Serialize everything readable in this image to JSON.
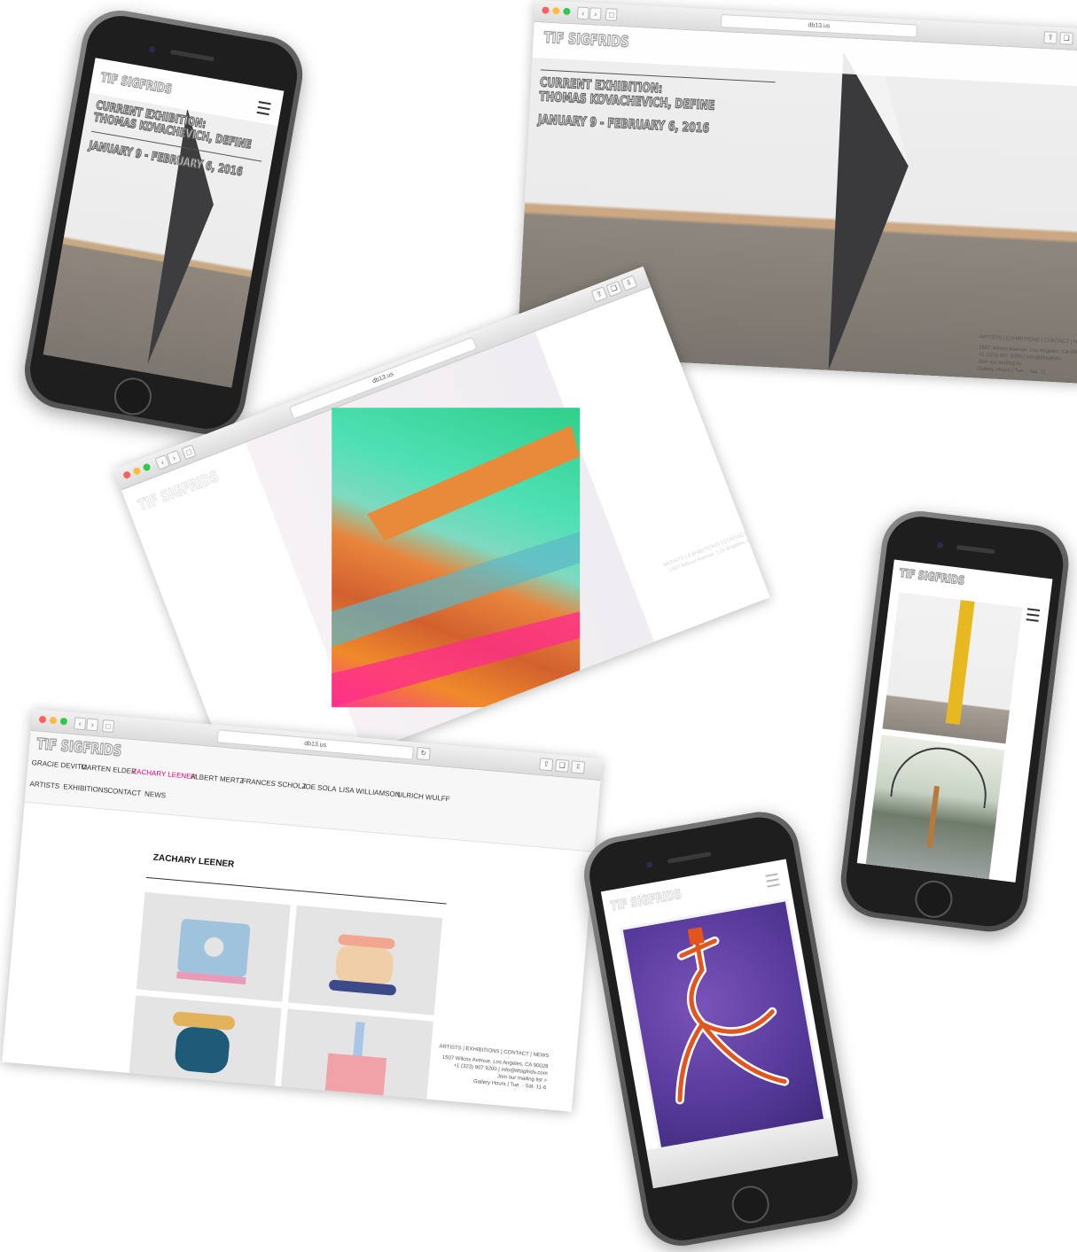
{
  "site": {
    "logo": "TIF SIGFRIDS",
    "url": "db13.us"
  },
  "exhibition": {
    "label": "CURRENT EXHIBITION:",
    "title": "THOMAS KOVACHEVICH, DEFINE",
    "dates": "JANUARY 9 - FEBRUARY 6, 2016"
  },
  "footer": {
    "links": "ARTISTS  |  EXHIBITIONS  |  CONTACT  |  NEWS",
    "links_short": "ARTISTS  |  EXHIBITIONS  |  CONTACT  |  NE",
    "address": "1507 Wilcox Avenue, Los Angeles, CA 90028",
    "address_short": "1507 Wilcox Avenue, Los Angeles, CA 900",
    "contact": "+1 (323) 907 9200  |  info@tifsigfrids.com",
    "contact_short": "+1 (323) 907 9200  |  info@tifsigfrids.",
    "mailing": "Join our mailing list >",
    "mailing_short": "Join our mailing lis",
    "hours": "Gallery Hours | Tue. - Sat. 11-6",
    "hours_short": "Gallery Hours | Tue. - Sat. 11"
  },
  "artists_page": {
    "artists": [
      "GRACIE DEVITO",
      "MARTEN ELDER",
      "ZACHARY LEENER",
      "ALBERT MERTZ",
      "FRANCES SCHOLZ",
      "JOE SOLA",
      "LISA WILLIAMSON",
      "ULRICH WULFF"
    ],
    "active_artist": "ZACHARY LEENER",
    "menu": [
      "ARTISTS",
      "EXHIBITIONS",
      "CONTACT",
      "NEWS"
    ],
    "heading": "ZACHARY LEENER"
  },
  "colors": {
    "active_link": "#e6007e",
    "traffic_red": "#fc605c",
    "traffic_yellow": "#fdbc40",
    "traffic_green": "#34c84a"
  },
  "icons": [
    "back-chevron-icon",
    "forward-chevron-icon",
    "sidebar-icon",
    "reload-icon",
    "share-icon",
    "tabs-icon",
    "download-icon",
    "hamburger-menu-icon"
  ]
}
